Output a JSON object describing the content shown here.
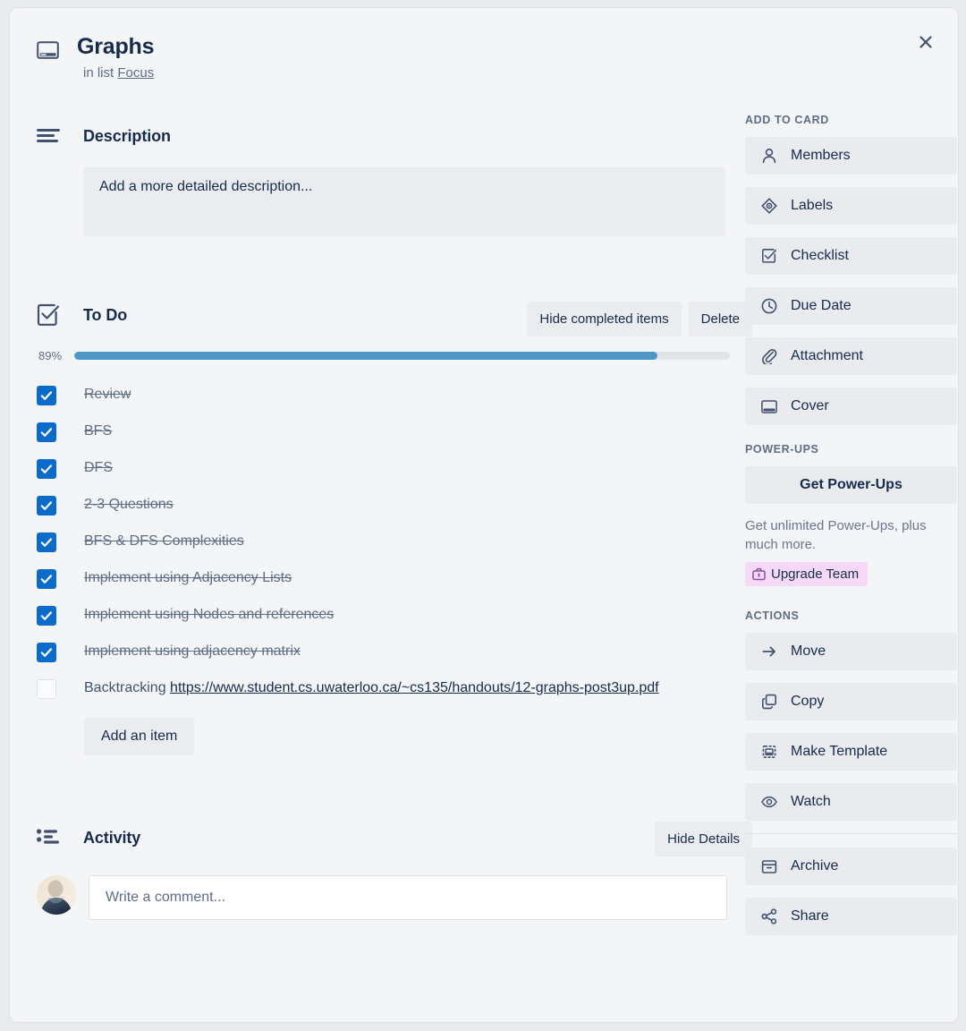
{
  "colors": {
    "modal_bg": "#f4f5f7",
    "accent_blue": "#0b6bcb",
    "progress_fill": "#4d96c8",
    "progress_track": "#e2e4e9",
    "button_grey": "#ebecf0",
    "text_dark": "#172b4d",
    "text_muted": "#5e6c84",
    "upgrade_badge_bg": "#f5d9f7"
  },
  "close_button": {
    "icon": "close-icon",
    "label": "×"
  },
  "header": {
    "icon": "card-cover-icon",
    "title": "Graphs",
    "subtitle_prefix": "in list",
    "list_name": "Focus"
  },
  "description": {
    "icon": "description-lines-icon",
    "title": "Description",
    "placeholder": "Add a more detailed description...",
    "value": ""
  },
  "checklist": {
    "icon": "checklist-icon",
    "title": "To Do",
    "hide_completed_label": "Hide completed items",
    "delete_label": "Delete",
    "progress_percent_label": "89%",
    "progress_percent": 89,
    "add_item_label": "Add an item",
    "items": [
      {
        "text": "Review",
        "checked": true
      },
      {
        "text": "BFS",
        "checked": true
      },
      {
        "text": "DFS",
        "checked": true
      },
      {
        "text": "2-3 Questions",
        "checked": true
      },
      {
        "text": "BFS & DFS Complexities",
        "checked": true
      },
      {
        "text": "Implement using Adjacency Lists",
        "checked": true
      },
      {
        "text": "Implement using Nodes and references",
        "checked": true
      },
      {
        "text": "Implement using adjacency matrix",
        "checked": true
      },
      {
        "text": "Backtracking ",
        "link": "https://www.student.cs.uwaterloo.ca/~cs135/handouts/12-graphs-post3up.pdf",
        "checked": false
      }
    ]
  },
  "activity": {
    "icon": "activity-list-icon",
    "title": "Activity",
    "hide_details_label": "Hide Details",
    "avatar": "user-avatar",
    "comment_placeholder": "Write a comment...",
    "comment_value": ""
  },
  "sidebar": {
    "add_to_card": {
      "title": "ADD TO CARD",
      "items": [
        {
          "label": "Members",
          "icon": "person-icon"
        },
        {
          "label": "Labels",
          "icon": "label-tag-icon"
        },
        {
          "label": "Checklist",
          "icon": "checklist-icon"
        },
        {
          "label": "Due Date",
          "icon": "clock-icon"
        },
        {
          "label": "Attachment",
          "icon": "paperclip-icon"
        },
        {
          "label": "Cover",
          "icon": "cover-icon"
        }
      ]
    },
    "power_ups": {
      "title": "POWER-UPS",
      "get_label": "Get Power-Ups",
      "note": "Get unlimited Power-Ups, plus much more.",
      "upgrade_label": "Upgrade Team",
      "upgrade_icon": "briefcase-icon"
    },
    "actions": {
      "title": "ACTIONS",
      "items": [
        {
          "label": "Move",
          "icon": "arrow-right-icon"
        },
        {
          "label": "Copy",
          "icon": "copy-icon"
        },
        {
          "label": "Make Template",
          "icon": "template-icon"
        },
        {
          "label": "Watch",
          "icon": "eye-icon"
        }
      ],
      "items_secondary": [
        {
          "label": "Archive",
          "icon": "archive-box-icon"
        },
        {
          "label": "Share",
          "icon": "share-nodes-icon"
        }
      ]
    }
  }
}
